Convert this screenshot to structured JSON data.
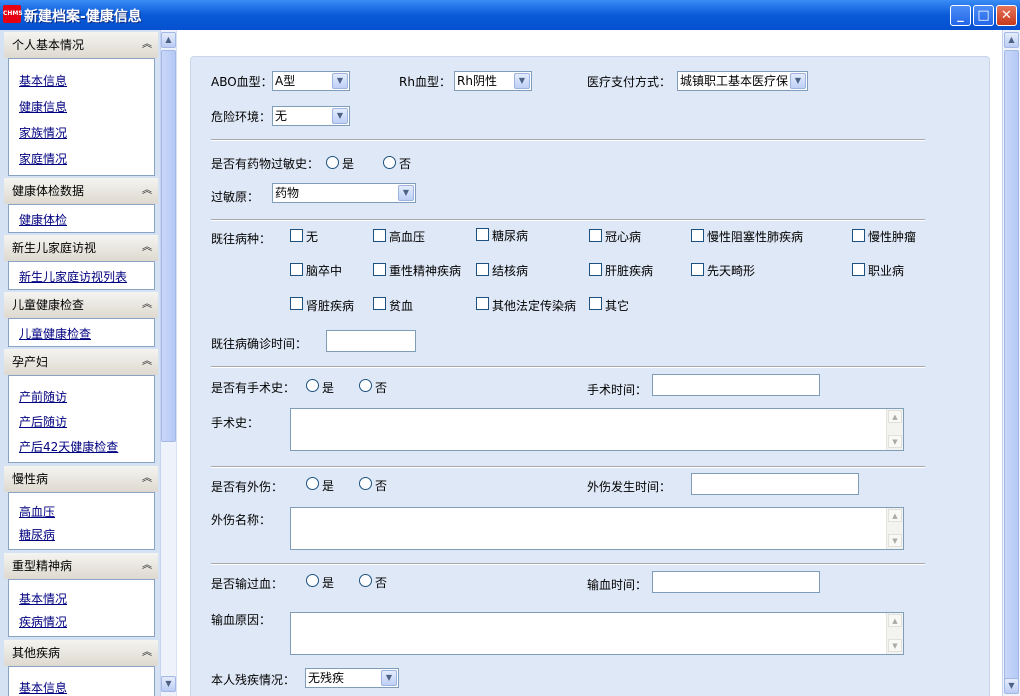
{
  "window": {
    "title": "新建档案-健康信息",
    "app_icon_text": "CHMS",
    "min_label": "_",
    "max_label": "□",
    "close_label": "✕"
  },
  "sidebar": {
    "collapse_glyph": "︽",
    "groups": [
      {
        "title": "个人基本情况",
        "items": [
          "基本信息",
          "健康信息",
          "家族情况",
          "家庭情况"
        ]
      },
      {
        "title": "健康体检数据",
        "items": [
          "健康体检"
        ]
      },
      {
        "title": "新生儿家庭访视",
        "items": [
          "新生儿家庭访视列表"
        ]
      },
      {
        "title": "儿童健康检查",
        "items": [
          "儿童健康检查"
        ]
      },
      {
        "title": "孕产妇",
        "items": [
          "产前随访",
          "产后随访",
          "产后42天健康检查"
        ]
      },
      {
        "title": "慢性病",
        "items": [
          "高血压",
          "糖尿病"
        ]
      },
      {
        "title": "重型精神病",
        "items": [
          "基本情况",
          "疾病情况"
        ]
      },
      {
        "title": "其他疾病",
        "items": [
          "基本信息"
        ]
      }
    ]
  },
  "scroll": {
    "up": "▲",
    "down": "▼"
  },
  "form": {
    "abo": {
      "label": "ABO血型：",
      "value": "A型"
    },
    "rh": {
      "label": "Rh血型：",
      "value": "Rh阴性"
    },
    "payment": {
      "label": "医疗支付方式：",
      "value": "城镇职工基本医疗保"
    },
    "danger": {
      "label": "危险环境：",
      "value": "无"
    },
    "allergy_history": {
      "label": "是否有药物过敏史：",
      "yes": "是",
      "no": "否"
    },
    "allergen": {
      "label": "过敏原：",
      "value": "药物"
    },
    "past_disease": {
      "label": "既往病种：",
      "options": [
        "无",
        "高血压",
        "糖尿病",
        "冠心病",
        "慢性阻塞性肺疾病",
        "慢性肿瘤",
        "脑卒中",
        "重性精神疾病",
        "结核病",
        "肝脏疾病",
        "先天畸形",
        "职业病",
        "肾脏疾病",
        "贫血",
        "其他法定传染病",
        "其它"
      ]
    },
    "diagnosis_time": {
      "label": "既往病确诊时间："
    },
    "surgery": {
      "label": "是否有手术史：",
      "yes": "是",
      "no": "否",
      "time_label": "手术时间：",
      "history_label": "手术史："
    },
    "trauma": {
      "label": "是否有外伤：",
      "yes": "是",
      "no": "否",
      "time_label": "外伤发生时间：",
      "name_label": "外伤名称："
    },
    "transfusion": {
      "label": "是否输过血：",
      "yes": "是",
      "no": "否",
      "time_label": "输血时间：",
      "reason_label": "输血原因："
    },
    "disability": {
      "label": "本人残疾情况：",
      "value": "无残疾"
    }
  }
}
